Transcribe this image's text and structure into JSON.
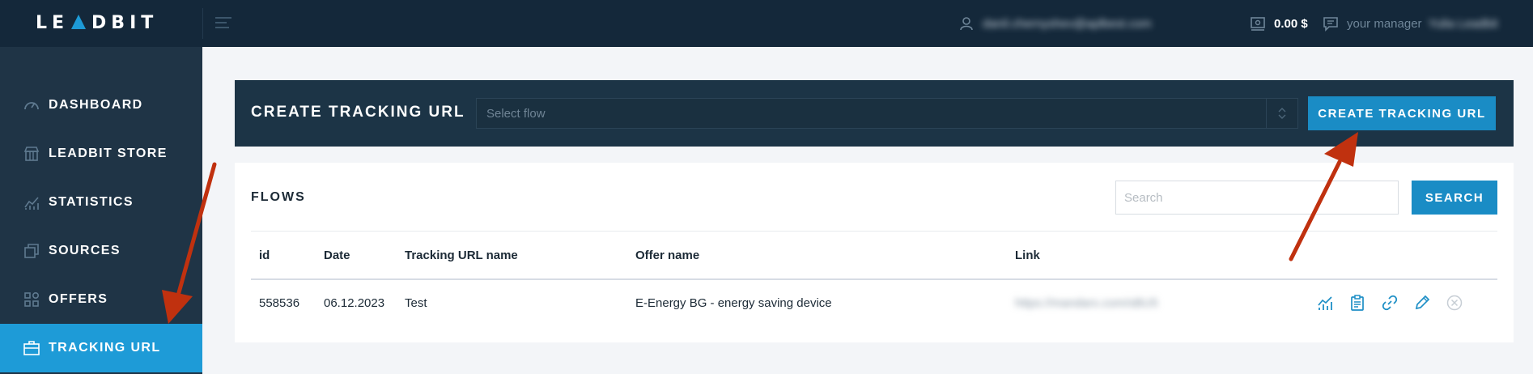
{
  "header": {
    "logo_text": "LEADBIT",
    "user_email": "danil.chernyshev@aplbest.com",
    "balance": "0.00 $",
    "manager_label": "your manager",
    "manager_name": "Yulia Leadbit"
  },
  "sidebar": {
    "items": [
      {
        "label": "DASHBOARD",
        "icon": "gauge-icon"
      },
      {
        "label": "LEADBIT STORE",
        "icon": "store-icon"
      },
      {
        "label": "STATISTICS",
        "icon": "chart-icon"
      },
      {
        "label": "SOURCES",
        "icon": "layers-icon"
      },
      {
        "label": "OFFERS",
        "icon": "grid-icon"
      },
      {
        "label": "TRACKING URL",
        "icon": "briefcase-icon",
        "active": true
      }
    ]
  },
  "create_panel": {
    "title": "CREATE TRACKING URL",
    "select_placeholder": "Select flow",
    "button_label": "CREATE TRACKING URL"
  },
  "flows_panel": {
    "title": "FLOWS",
    "search_placeholder": "Search",
    "search_button": "SEARCH",
    "columns": [
      "id",
      "Date",
      "Tracking URL name",
      "Offer name",
      "Link"
    ],
    "rows": [
      {
        "id": "558536",
        "date": "06.12.2023",
        "name": "Test",
        "offer": "E-Energy BG - energy saving device",
        "link": "https://mandarx.com/sBU5"
      }
    ],
    "row_actions": [
      "statistics-icon",
      "clipboard-icon",
      "link-icon",
      "edit-icon",
      "delete-icon"
    ]
  },
  "colors": {
    "topbar": "#14283a",
    "sidebar": "#1f3446",
    "accent": "#1e9bd7",
    "annotation_arrow": "#c0310f"
  }
}
